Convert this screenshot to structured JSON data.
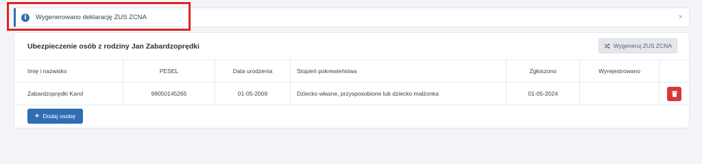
{
  "alert": {
    "icon": "info-icon",
    "message": "Wygenerowano deklarację ZUS ZCNA",
    "close": "×"
  },
  "card": {
    "title": "Ubezpieczenie osób z rodziny Jan Zabardzoprędki",
    "generate_button": "Wygeneruj ZUS ZCNA",
    "add_button": "Dodaj osobę"
  },
  "table": {
    "headers": {
      "name": "Imię i nazwisko",
      "pesel": "PESEL",
      "birth_date": "Data urodzenia",
      "relation": "Stopień pokrewieństwa",
      "registered": "Zgłoszono",
      "deregistered": "Wyrejestrowano"
    },
    "rows": [
      {
        "name": "Zabardzoprędki Karol",
        "pesel": "99050145265",
        "birth_date": "01-05-2009",
        "relation": "Dziecko własne, przysposobione lub dziecko małżonka",
        "registered": "01-05-2024",
        "deregistered": ""
      }
    ]
  },
  "colors": {
    "primary": "#2f6db5",
    "danger": "#d9383a",
    "highlight": "#e02020"
  }
}
